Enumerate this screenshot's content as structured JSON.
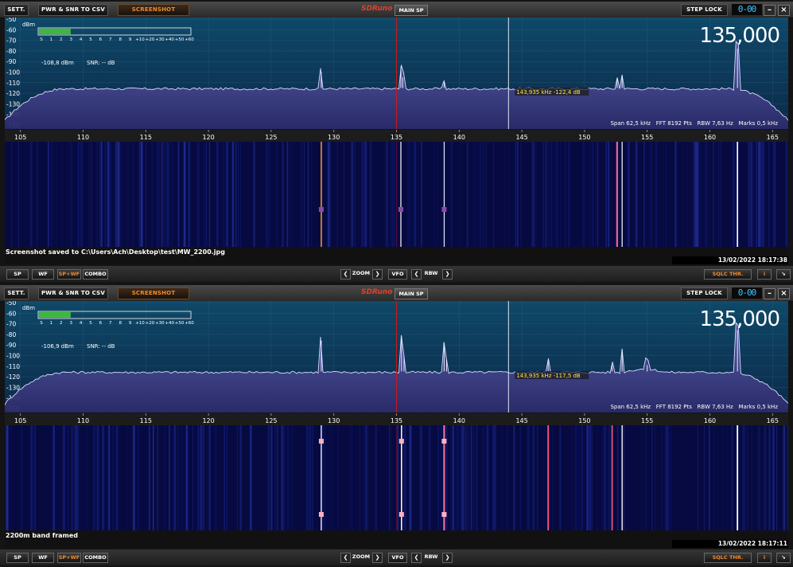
{
  "panels": [
    {
      "toolbar": {
        "sett": "SETT.",
        "pwr_csv": "PWR & SNR TO CSV",
        "screenshot": "SCREENSHOT",
        "logo": "SDRuno",
        "main_sp": "MAIN SP",
        "step_lock": "STEP LOCK",
        "readout": "0-00"
      },
      "smeter": {
        "unit": "dBm",
        "scale": [
          "S",
          "1",
          "2",
          "3",
          "4",
          "5",
          "6",
          "7",
          "8",
          "9",
          "+10",
          "+20",
          "+30",
          "+40",
          "+50",
          "+60"
        ],
        "level": 0.21,
        "dbm": "-108,8 dBm",
        "snr": "SNR: -- dB"
      },
      "frequency": "135,000",
      "marker": "143,935 kHz -122,4 dB",
      "info": "Span 62,5 kHz   FFT 8192 Pts   RBW 7,63 Hz   Marks 0,5 kHz",
      "status_msg": "Screenshot saved to C:\\Users\\Ach\\Desktop\\test\\MW_2200.jpg",
      "timestamp": "13/02/2022 18:17:38",
      "bottombar": {
        "sp": "SP",
        "wf": "WF",
        "spwf": "SP+WF",
        "combo": "COMBO",
        "zoom": "ZOOM",
        "vfo": "VFO",
        "rbw": "RBW",
        "sqlc": "SQLC THR.",
        "info": "i"
      }
    },
    {
      "toolbar": {
        "sett": "SETT.",
        "pwr_csv": "PWR & SNR TO CSV",
        "screenshot": "SCREENSHOT",
        "logo": "SDRuno",
        "main_sp": "MAIN SP",
        "step_lock": "STEP LOCK",
        "readout": "0-00"
      },
      "smeter": {
        "unit": "dBm",
        "scale": [
          "S",
          "1",
          "2",
          "3",
          "4",
          "5",
          "6",
          "7",
          "8",
          "9",
          "+10",
          "+20",
          "+30",
          "+40",
          "+50",
          "+60"
        ],
        "level": 0.21,
        "dbm": "-106,9 dBm",
        "snr": "SNR: -- dB"
      },
      "frequency": "135,000",
      "marker": "143,935 kHz -117,5 dB",
      "info": "Span 62,5 kHz   FFT 8192 Pts   RBW 7,63 Hz   Marks 0,5 kHz",
      "status_msg": "2200m band framed",
      "timestamp": "13/02/2022 18:17:11",
      "bottombar": {
        "sp": "SP",
        "wf": "WF",
        "spwf": "SP+WF",
        "combo": "COMBO",
        "zoom": "ZOOM",
        "vfo": "VFO",
        "rbw": "RBW",
        "sqlc": "SQLC THR.",
        "info": "i"
      }
    }
  ],
  "y_axis_labels": [
    "-50",
    "-60",
    "-70",
    "-80",
    "-90",
    "-100",
    "-110",
    "-120",
    "-130",
    "-140",
    "-150"
  ],
  "x_axis_labels": [
    "105",
    "110",
    "115",
    "120",
    "125",
    "130",
    "135",
    "140",
    "145",
    "150",
    "155",
    "160",
    "165"
  ],
  "colors": {
    "accent_orange": "#f38a2a",
    "frequency_text": "#ffffff",
    "readout_blue": "#3fc6ff",
    "marker_yellow": "#ffe94a",
    "spectrum_fill": "#3a3e8a",
    "waterfall_bg": "#070a40",
    "center_line": "#d01818"
  },
  "chart_data": [
    {
      "type": "line",
      "xlabel": "",
      "ylabel": "dBm",
      "x_range_khz": [
        103.75,
        166.25
      ],
      "ylim": [
        -150,
        -50
      ],
      "noise_floor_db": -115,
      "center_khz": 135.0,
      "marker_khz": 143.935,
      "peaks": [
        {
          "x": 129.0,
          "y": -100
        },
        {
          "x": 135.35,
          "y": -95
        },
        {
          "x": 135.5,
          "y": -105
        },
        {
          "x": 138.8,
          "y": -109
        },
        {
          "x": 152.6,
          "y": -106
        },
        {
          "x": 153.0,
          "y": -103
        },
        {
          "x": 162.2,
          "y": -78
        }
      ]
    },
    {
      "type": "line",
      "xlabel": "",
      "ylabel": "dBm",
      "x_range_khz": [
        103.75,
        166.25
      ],
      "ylim": [
        -150,
        -50
      ],
      "noise_floor_db": -115,
      "center_khz": 135.0,
      "marker_khz": 143.935,
      "peaks": [
        {
          "x": 129.0,
          "y": -86
        },
        {
          "x": 135.4,
          "y": -82
        },
        {
          "x": 135.6,
          "y": -100
        },
        {
          "x": 138.8,
          "y": -88
        },
        {
          "x": 139.0,
          "y": -104
        },
        {
          "x": 147.1,
          "y": -104
        },
        {
          "x": 152.2,
          "y": -108
        },
        {
          "x": 153.0,
          "y": -94
        },
        {
          "x": 155.0,
          "y": -109
        },
        {
          "x": 162.2,
          "y": -76
        }
      ]
    }
  ]
}
